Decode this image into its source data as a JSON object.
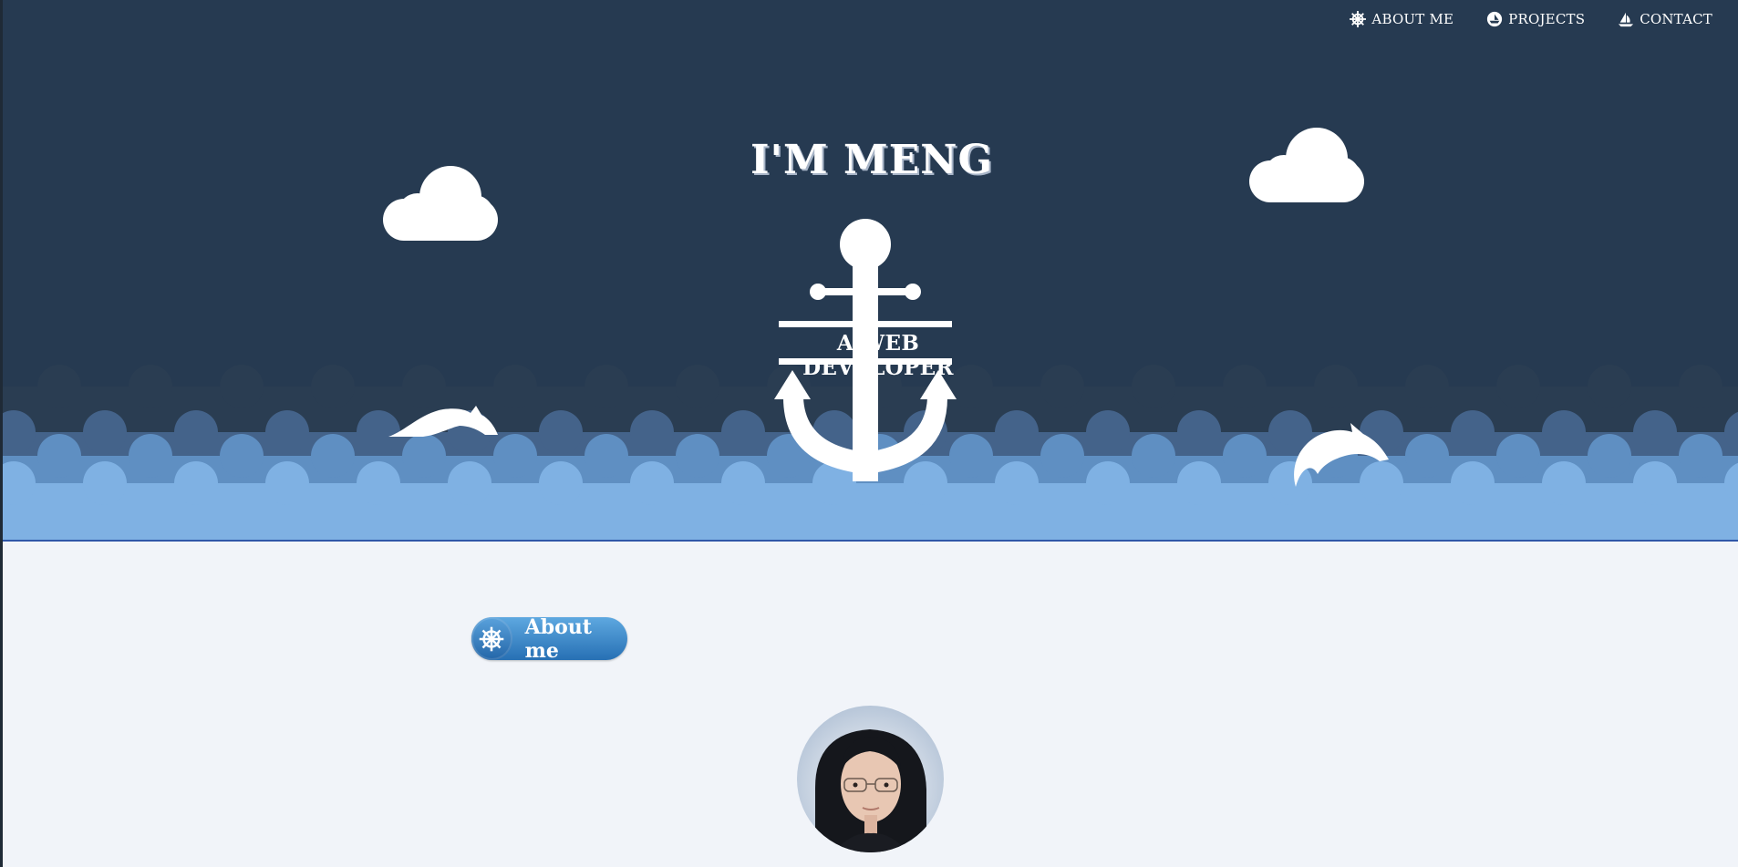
{
  "nav": {
    "items": [
      {
        "label": "About me",
        "icon": "ship-wheel-icon"
      },
      {
        "label": "Projects",
        "icon": "boat-icon"
      },
      {
        "label": "Contact",
        "icon": "sailboat-icon"
      }
    ]
  },
  "hero": {
    "title": "I'M MENG",
    "subtitle": "A WEB DEVELOPER"
  },
  "section": {
    "about_label": "About me"
  },
  "colors": {
    "sky": "#263a51",
    "wave_dark": "#2a3d52",
    "wave_mid1": "#44638a",
    "wave_mid2": "#5f8fc2",
    "wave_light": "#7fb1e3",
    "page_bg": "#f1f4f9",
    "button_blue": "#2f82c6"
  }
}
